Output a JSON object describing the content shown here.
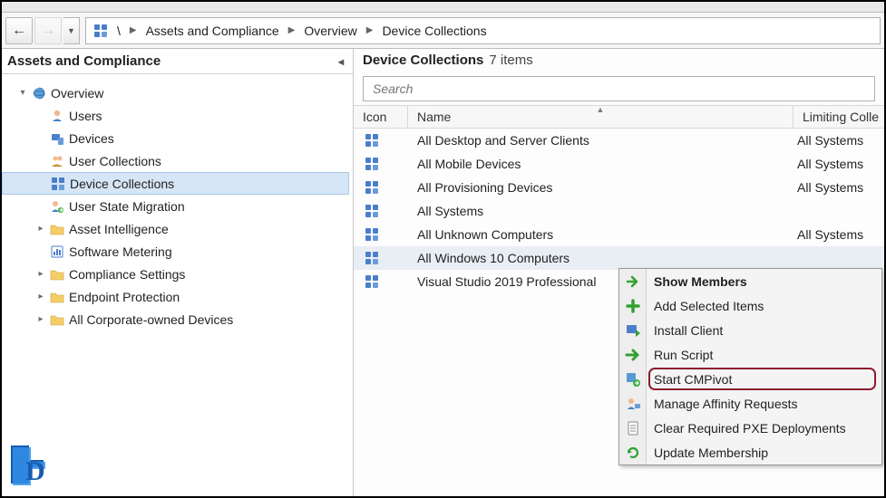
{
  "breadcrumb": {
    "parts": [
      "\\",
      "Assets and Compliance",
      "Overview",
      "Device Collections"
    ]
  },
  "sidebar": {
    "title": "Assets and Compliance",
    "items": [
      {
        "label": "Overview",
        "icon": "sphere",
        "indent": 1,
        "expander": "▾"
      },
      {
        "label": "Users",
        "icon": "user",
        "indent": 2,
        "expander": ""
      },
      {
        "label": "Devices",
        "icon": "devices",
        "indent": 2,
        "expander": ""
      },
      {
        "label": "User Collections",
        "icon": "usercoll",
        "indent": 2,
        "expander": ""
      },
      {
        "label": "Device Collections",
        "icon": "devcoll",
        "indent": 2,
        "expander": "",
        "selected": true
      },
      {
        "label": "User State Migration",
        "icon": "usm",
        "indent": 2,
        "expander": ""
      },
      {
        "label": "Asset Intelligence",
        "icon": "folder",
        "indent": 2,
        "expander": "▸"
      },
      {
        "label": "Software Metering",
        "icon": "meter",
        "indent": 2,
        "expander": ""
      },
      {
        "label": "Compliance Settings",
        "icon": "folder",
        "indent": 2,
        "expander": "▸"
      },
      {
        "label": "Endpoint Protection",
        "icon": "folder",
        "indent": 2,
        "expander": "▸"
      },
      {
        "label": "All Corporate-owned Devices",
        "icon": "folder",
        "indent": 2,
        "expander": "▸"
      }
    ]
  },
  "main": {
    "title_prefix": "Device Collections",
    "item_count_text": "7 items",
    "search_placeholder": "Search",
    "cols": {
      "icon": "Icon",
      "name": "Name",
      "limit": "Limiting Colle"
    },
    "rows": [
      {
        "name": "All Desktop and Server Clients",
        "limit": "All Systems"
      },
      {
        "name": "All Mobile Devices",
        "limit": "All Systems"
      },
      {
        "name": "All Provisioning Devices",
        "limit": "All Systems"
      },
      {
        "name": "All Systems",
        "limit": ""
      },
      {
        "name": "All Unknown Computers",
        "limit": "All Systems"
      },
      {
        "name": "All Windows 10 Computers",
        "limit": "",
        "selected": true
      },
      {
        "name": "Visual Studio 2019 Professional",
        "limit": ""
      }
    ]
  },
  "context_menu": {
    "items": [
      {
        "label": "Show Members",
        "icon": "arrow-green-right",
        "bold": true
      },
      {
        "label": "Add Selected Items",
        "icon": "plus-green"
      },
      {
        "label": "Install Client",
        "icon": "install"
      },
      {
        "label": "Run Script",
        "icon": "arrow-green-bold"
      },
      {
        "label": "Start CMPivot",
        "icon": "cmpivot",
        "highlight": true
      },
      {
        "label": "Manage Affinity Requests",
        "icon": "affinity"
      },
      {
        "label": "Clear Required PXE Deployments",
        "icon": "doc"
      },
      {
        "label": "Update Membership",
        "icon": "refresh"
      }
    ]
  }
}
